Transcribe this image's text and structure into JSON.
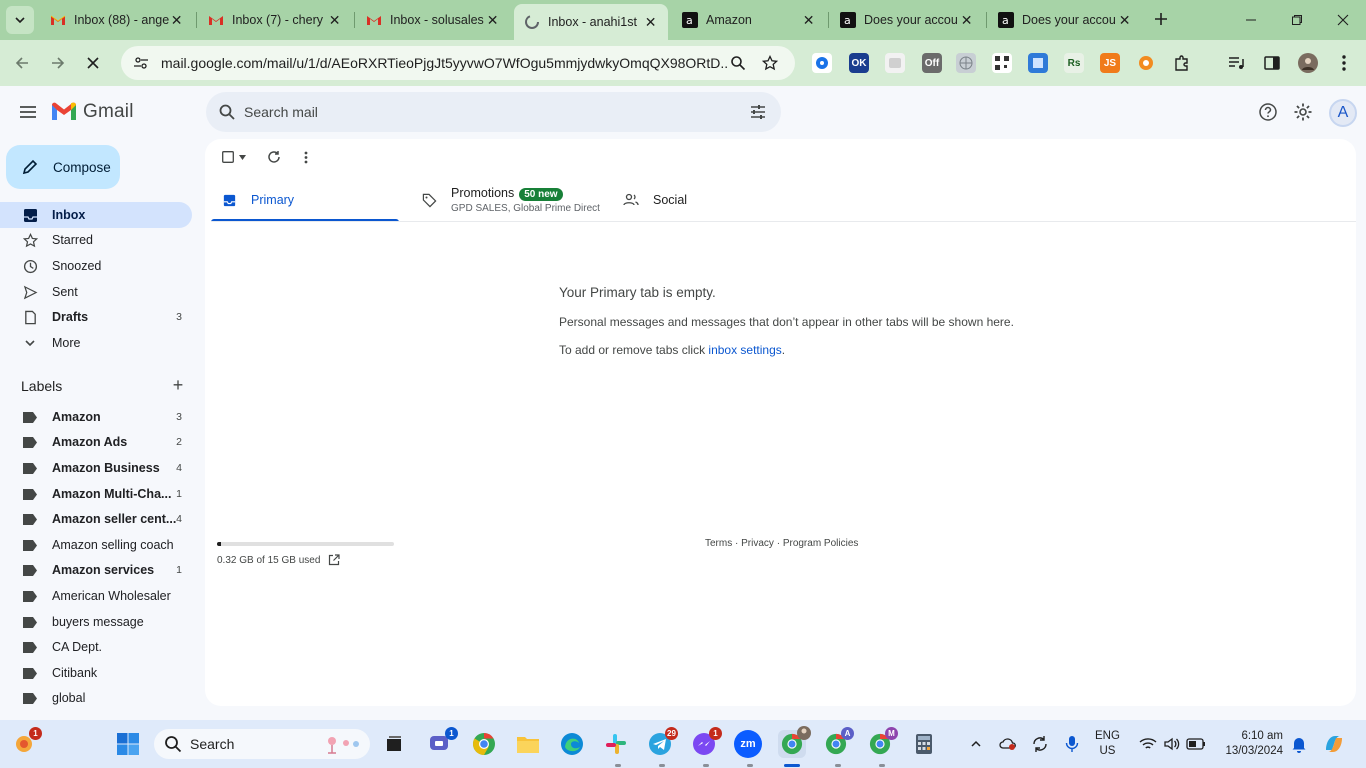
{
  "browser": {
    "tabs": [
      {
        "title": "Inbox (88) - ange",
        "favicon": "gmail-icon"
      },
      {
        "title": "Inbox (7) - chery",
        "favicon": "gmail-icon"
      },
      {
        "title": "Inbox - solusales",
        "favicon": "gmail-icon"
      },
      {
        "title": "Inbox - anahi1st",
        "favicon": "loading-icon",
        "active": true
      },
      {
        "title": "Amazon",
        "favicon": "amazon-icon"
      },
      {
        "title": "Does your accou",
        "favicon": "amazon-icon"
      },
      {
        "title": "Does your accou",
        "favicon": "amazon-icon"
      }
    ],
    "url": "mail.google.com/mail/u/1/d/AEoRXRTieoPjgJt5yyvwO7WfOgu5mmjydwkyOmqQX98ORtD...",
    "extension_labels": {
      "ok": "OK",
      "off": "Off",
      "js": "JS"
    }
  },
  "gmail": {
    "logo_text": "Gmail",
    "search_placeholder": "Search mail",
    "compose_label": "Compose",
    "nav": [
      {
        "label": "Inbox",
        "icon": "inbox-icon",
        "count": "",
        "active": true
      },
      {
        "label": "Starred",
        "icon": "star-icon",
        "count": ""
      },
      {
        "label": "Snoozed",
        "icon": "clock-icon",
        "count": ""
      },
      {
        "label": "Sent",
        "icon": "send-icon",
        "count": ""
      },
      {
        "label": "Drafts",
        "icon": "draft-icon",
        "count": "3",
        "bold": true
      },
      {
        "label": "More",
        "icon": "chevron-down-icon",
        "count": ""
      }
    ],
    "labels_heading": "Labels",
    "labels": [
      {
        "label": "Amazon",
        "count": "3",
        "bold": true
      },
      {
        "label": "Amazon Ads",
        "count": "2",
        "bold": true
      },
      {
        "label": "Amazon Business",
        "count": "4",
        "bold": true
      },
      {
        "label": "Amazon Multi-Cha...",
        "count": "1",
        "bold": true
      },
      {
        "label": "Amazon seller cent...",
        "count": "4",
        "bold": true
      },
      {
        "label": "Amazon selling coach",
        "count": ""
      },
      {
        "label": "Amazon services",
        "count": "1",
        "bold": true
      },
      {
        "label": "American Wholesaler",
        "count": ""
      },
      {
        "label": "buyers message",
        "count": ""
      },
      {
        "label": "CA Dept.",
        "count": ""
      },
      {
        "label": "Citibank",
        "count": ""
      },
      {
        "label": "global",
        "count": ""
      }
    ],
    "avatar_letter": "A",
    "tabs": {
      "primary": "Primary",
      "promotions": "Promotions",
      "promotions_badge": "50 new",
      "promotions_sub": "GPD SALES, Global Prime Direct",
      "social": "Social"
    },
    "empty": {
      "title": "Your Primary tab is empty.",
      "line1": "Personal messages and messages that don’t appear in other tabs will be shown here.",
      "line2_prefix": "To add or remove tabs click ",
      "line2_link": "inbox settings",
      "line2_suffix": "."
    },
    "storage": {
      "text": "0.32 GB of 15 GB used",
      "used_fraction": 0.021
    },
    "footer": {
      "terms": "Terms",
      "privacy": "Privacy",
      "policies": "Program Policies",
      "sep": " · "
    }
  },
  "taskbar": {
    "search_label": "Search",
    "badges": {
      "meet": "1",
      "telegram": "29",
      "messenger": "1",
      "notif": "1"
    },
    "chrome_profile_a": "A",
    "chrome_profile_m": "M",
    "zoom_label": "zm",
    "lang_line1": "ENG",
    "lang_line2": "US",
    "time": "6:10 am",
    "date": "13/03/2024"
  }
}
